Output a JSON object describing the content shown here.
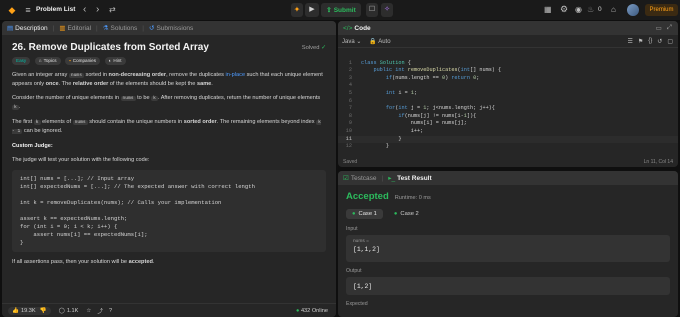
{
  "nav": {
    "problem_list": "Problem List",
    "run_icon": "play-icon",
    "submit": "Submit",
    "streak_count": "0",
    "premium": "Premium"
  },
  "left_tabs": {
    "description": "Description",
    "editorial": "Editorial",
    "solutions": "Solutions",
    "submissions": "Submissions"
  },
  "problem": {
    "title": "26. Remove Duplicates from Sorted Array",
    "status": "Solved",
    "tags": {
      "difficulty": "Easy",
      "topics": "Topics",
      "companies": "Companies",
      "hint": "Hint"
    },
    "p1a": "Given an integer array",
    "p1_code": "nums",
    "p1b": "sorted in",
    "p1_bold": "non-decreasing order",
    "p1c": ", remove the duplicates",
    "p1_link": "in-place",
    "p1d": "such that each unique element appears only",
    "p1_once": "once",
    "p1e": ". The",
    "p1_rel": "relative order",
    "p1f": "of the elements should be kept the",
    "p1_same": "same",
    "p1g": ".",
    "p2a": "Consider the number of unique elements in",
    "p2_code": "nums",
    "p2b": "to be",
    "p2_k": "k",
    "p2c": ". After removing duplicates, return the number of unique elements",
    "p2_k2": "k",
    "p2d": ".",
    "p3a": "The first",
    "p3_k": "k",
    "p3b": "elements of",
    "p3_code": "nums",
    "p3c": "should contain the unique numbers in",
    "p3_bold": "sorted order",
    "p3d": ". The remaining elements beyond index",
    "p3_idx": "k - 1",
    "p3e": "can be ignored.",
    "judge_heading": "Custom Judge:",
    "judge_text": "The judge will test your solution with the following code:",
    "judge_code": "int[] nums = [...]; // Input array\nint[] expectedNums = [...]; // The expected answer with correct length\n\nint k = removeDuplicates(nums); // Calls your implementation\n\nassert k == expectedNums.length;\nfor (int i = 0; i < k; i++) {\n    assert nums[i] == expectedNums[i];\n}",
    "p4a": "If all assertions pass, then your solution will be",
    "p4_bold": "accepted",
    "p4b": "."
  },
  "footer": {
    "likes": "19.3K",
    "comments": "1.1K",
    "online": "432 Online"
  },
  "code": {
    "title": "Code",
    "language": "Java",
    "auto": "Auto",
    "saved": "Saved",
    "position": "Ln 11, Col 14",
    "line_numbers": [
      "1",
      "2",
      "3",
      "4",
      "5",
      "6",
      "7",
      "8",
      "9",
      "10",
      "11",
      "12"
    ]
  },
  "result": {
    "testcase_tab": "Testcase",
    "result_tab": "Test Result",
    "verdict": "Accepted",
    "runtime": "Runtime: 0 ms",
    "case1": "Case 1",
    "case2": "Case 2",
    "input_label": "Input",
    "input_var": "nums =",
    "input_val": "[1,1,2]",
    "output_label": "Output",
    "output_val": "[1,2]",
    "expected_label": "Expected"
  },
  "colors": {
    "accepted": "#2cbb5d",
    "premium": "#ffa116",
    "easy": "#00b8a3"
  }
}
